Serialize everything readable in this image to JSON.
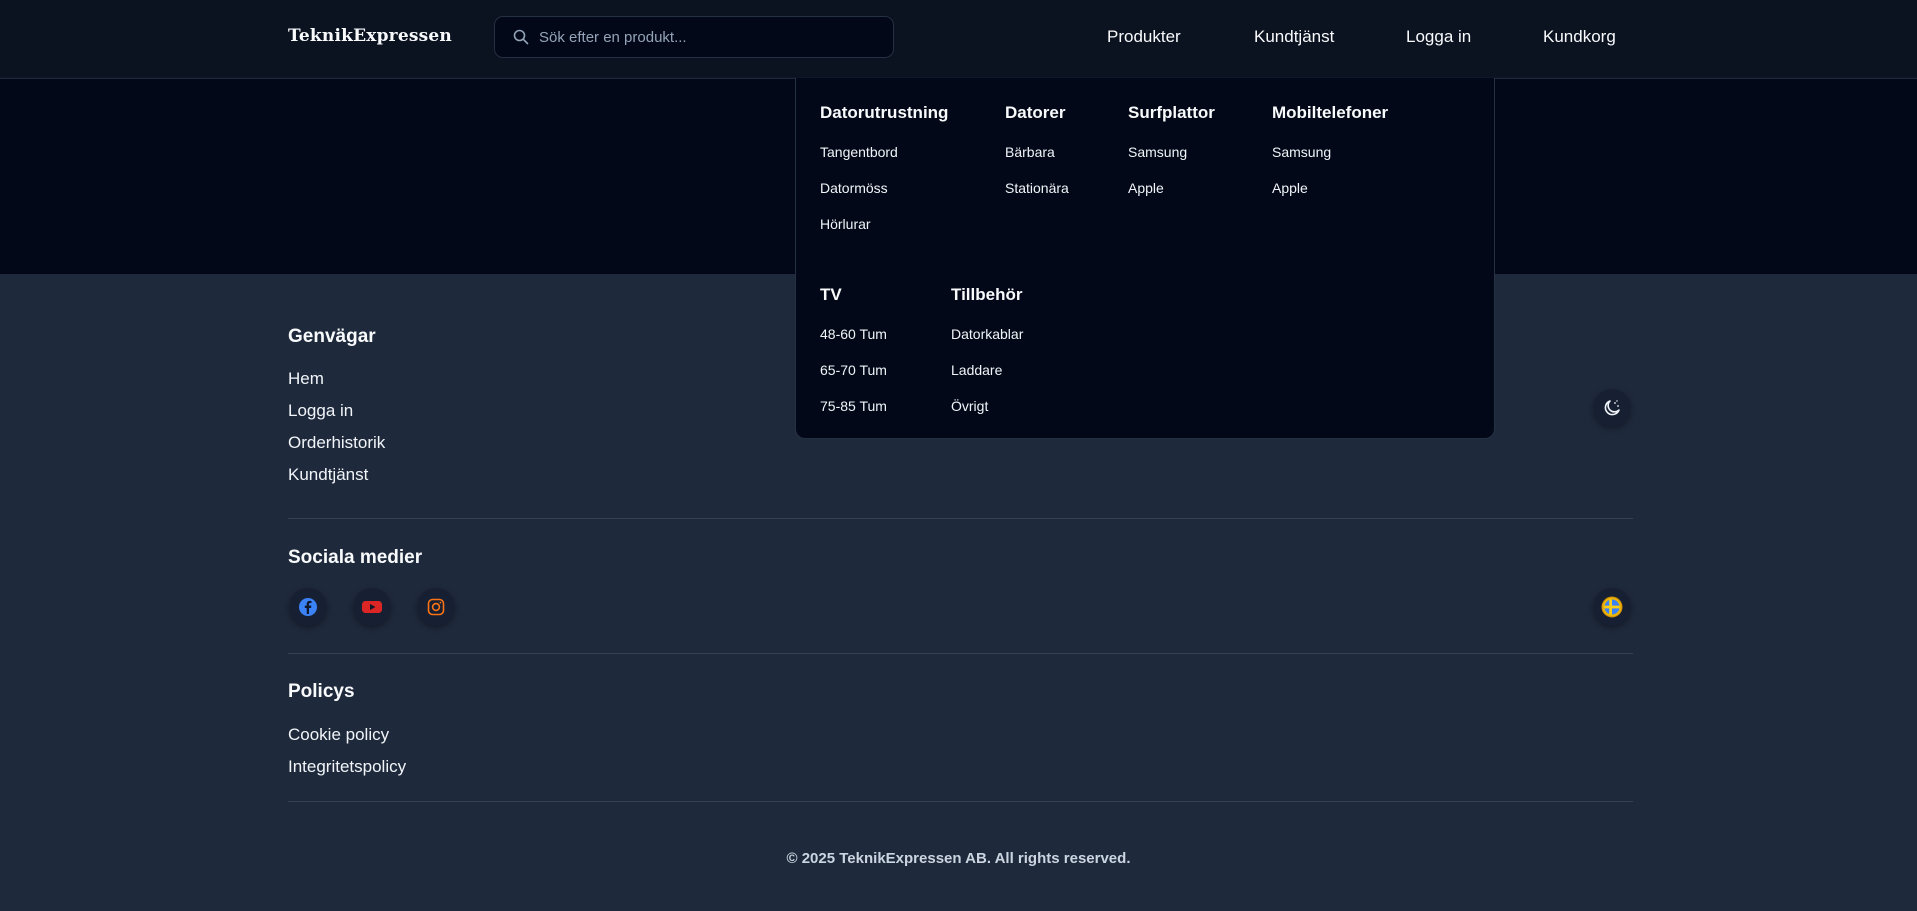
{
  "header": {
    "logo": "TeknikExpressen",
    "search_placeholder": "Sök efter en produkt...",
    "nav": [
      "Produkter",
      "Kundtjänst",
      "Logga in",
      "Kundkorg"
    ]
  },
  "mega_menu": {
    "categories": [
      {
        "title": "Datorutrustning",
        "items": [
          "Tangentbord",
          "Datormöss",
          "Hörlurar"
        ]
      },
      {
        "title": "Datorer",
        "items": [
          "Bärbara",
          "Stationära"
        ]
      },
      {
        "title": "Surfplattor",
        "items": [
          "Samsung",
          "Apple"
        ]
      },
      {
        "title": "Mobiltelefoner",
        "items": [
          "Samsung",
          "Apple"
        ]
      },
      {
        "title": "TV",
        "items": [
          "48-60 Tum",
          "65-70 Tum",
          "75-85 Tum"
        ]
      },
      {
        "title": "Tillbehör",
        "items": [
          "Datorkablar",
          "Laddare",
          "Övrigt"
        ]
      }
    ]
  },
  "footer": {
    "shortcuts_heading": "Genvägar",
    "shortcuts": [
      "Hem",
      "Logga in",
      "Orderhistorik",
      "Kundtjänst"
    ],
    "social_heading": "Sociala medier",
    "policies_heading": "Policys",
    "policies": [
      "Cookie policy",
      "Integritetspolicy"
    ],
    "copyright": "© 2025 TeknikExpressen AB. All rights reserved."
  },
  "icons": {
    "search": "search-icon",
    "theme": "moon-stars-icon",
    "facebook": "facebook-icon",
    "youtube": "youtube-icon",
    "instagram": "instagram-icon",
    "language": "swedish-flag-icon"
  },
  "colors": {
    "background": "#1e293b",
    "header": "#0b1220",
    "menu": "#020817",
    "facebook": "#3b82f6",
    "youtube": "#dc2626",
    "instagram": "#f97316"
  }
}
